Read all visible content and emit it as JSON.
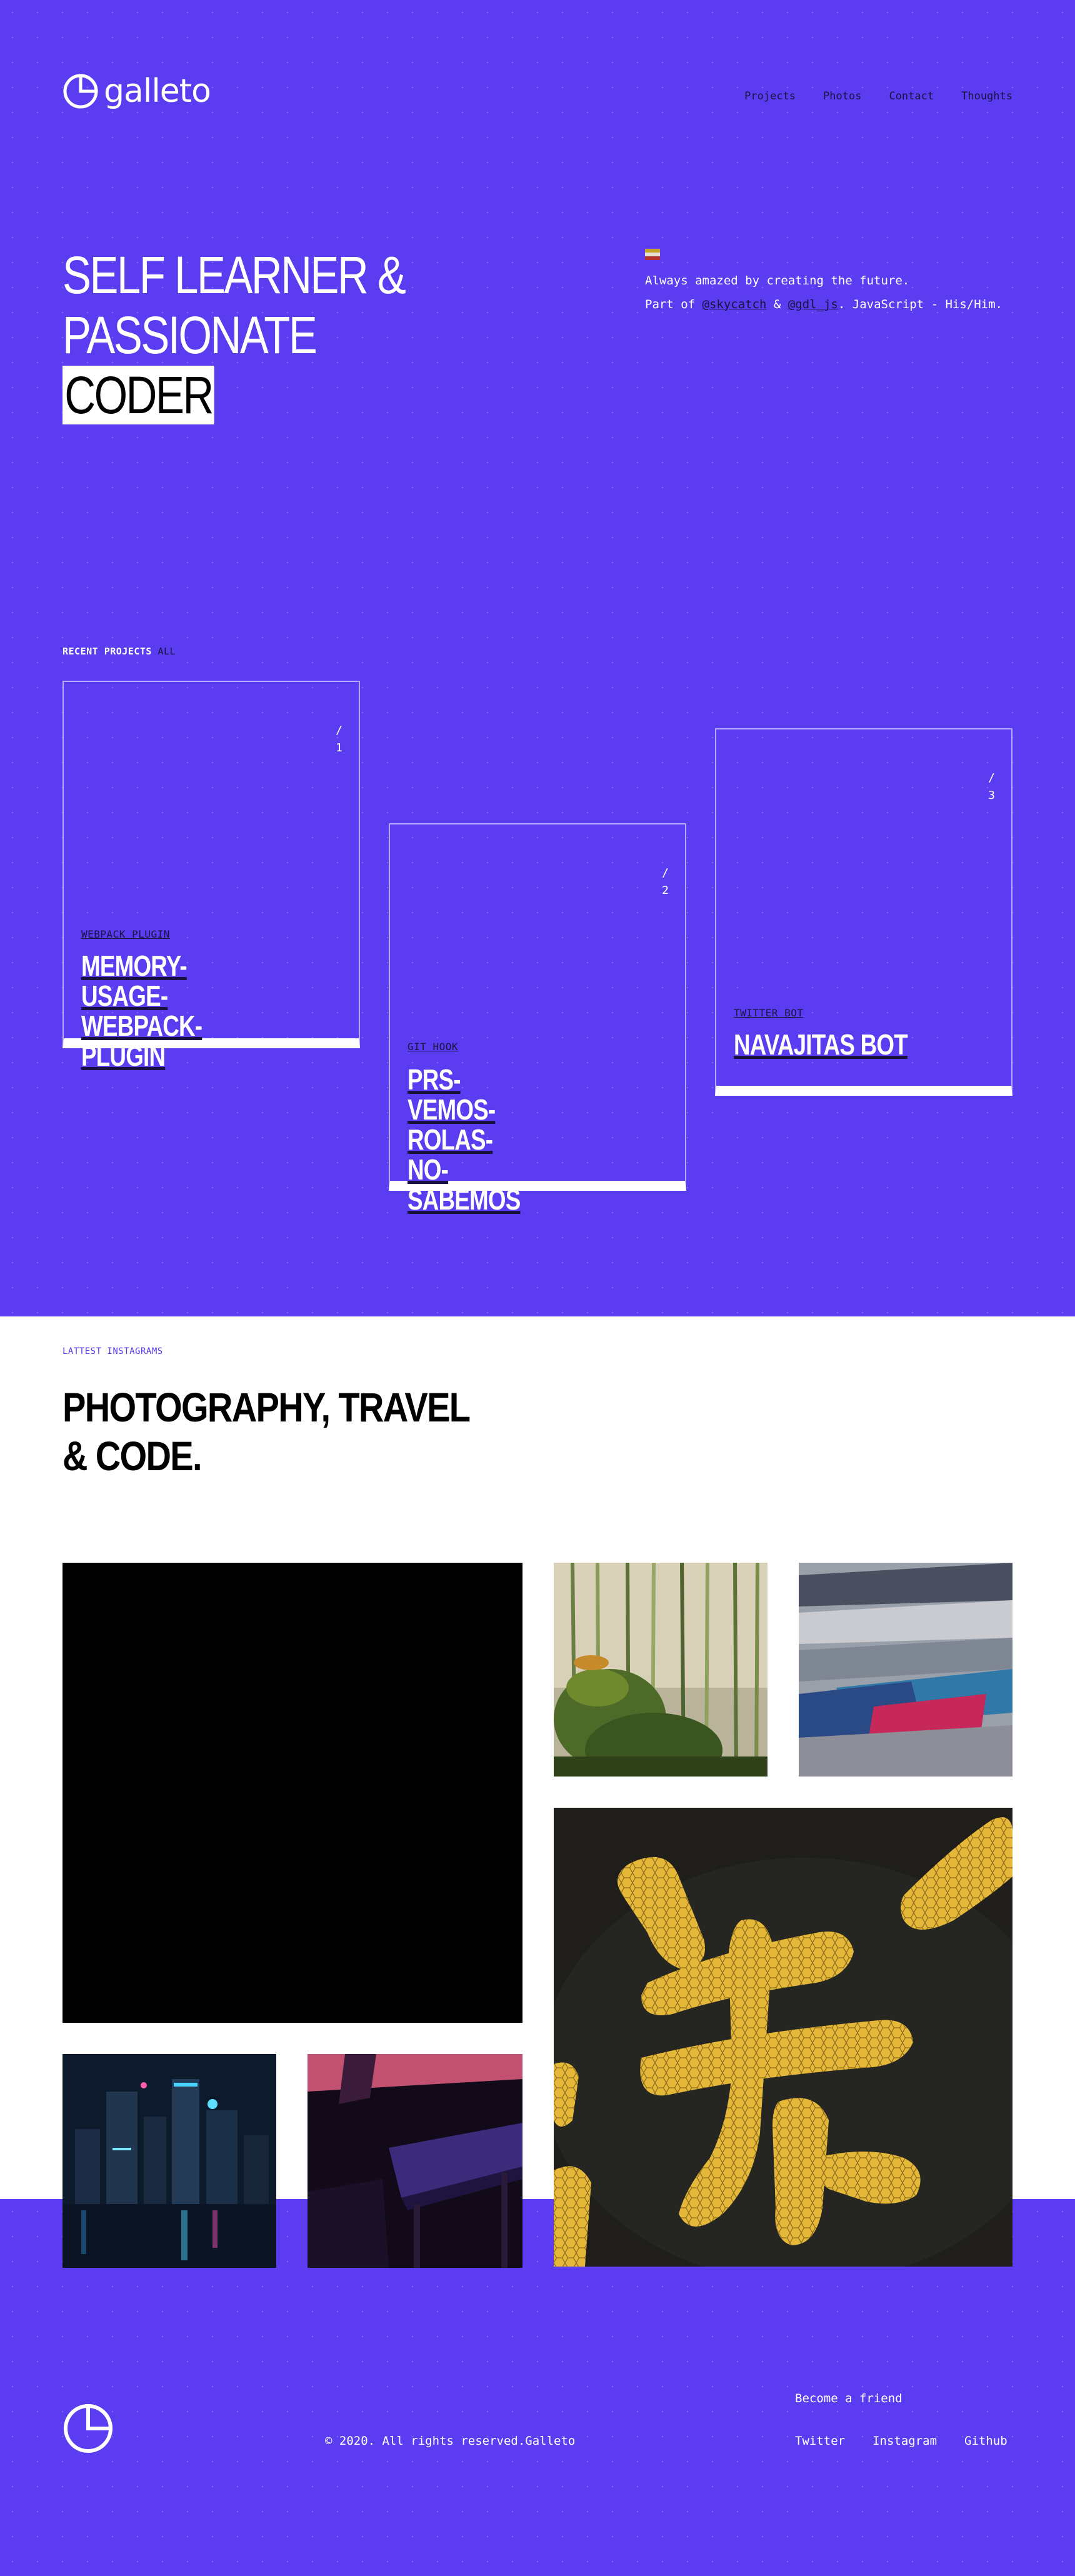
{
  "brand": {
    "name": "galleto"
  },
  "nav": {
    "items": [
      "Projects",
      "Photos",
      "Contact",
      "Thoughts"
    ]
  },
  "hero": {
    "headline_line1": "SELF LEARNER &",
    "headline_line2": "PASSIONATE",
    "headline_line3": "CODER",
    "intro_line1": "Always amazed by creating the future.",
    "intro_part_of": "Part of ",
    "intro_tag1": "@skycatch",
    "intro_and": " & ",
    "intro_tag2": "@gdl_js",
    "intro_rest": ". JavaScript - His/Him."
  },
  "projects": {
    "label": "RECENT PROJECTS",
    "all_link": "ALL",
    "items": [
      {
        "slash": "/",
        "number": "1",
        "category": "WEBPACK PLUGIN",
        "title": "MEMORY-USAGE-WEBPACK-PLUGIN"
      },
      {
        "slash": "/",
        "number": "2",
        "category": "GIT HOOK",
        "title": "PRS-VEMOS-ROLAS-NO-SABEMOS"
      },
      {
        "slash": "/",
        "number": "3",
        "category": "TWITTER BOT",
        "title": "NAVAJITAS BOT"
      }
    ]
  },
  "instagram": {
    "label": "LATTEST INSTAGRAMS",
    "title": "PHOTOGRAPHY, TRAVEL & CODE."
  },
  "footer": {
    "copyright": "© 2020. All rights reserved.Galleto",
    "befriend": "Become a friend",
    "social": [
      "Twitter",
      "Instagram",
      "Github"
    ]
  },
  "colors": {
    "brand": "#5b3cf0",
    "dark": "#1a1340",
    "white": "#ffffff"
  },
  "icons": [
    "galleto-logo-icon",
    "mexico-flag-icon"
  ]
}
